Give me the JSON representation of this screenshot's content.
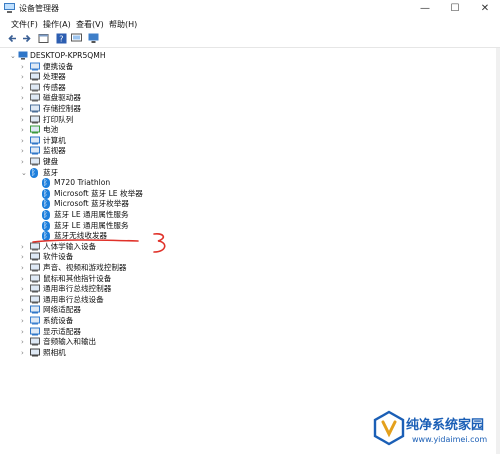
{
  "window": {
    "title": "设备管理器",
    "minimize": "—",
    "maximize": "☐",
    "close": "✕"
  },
  "menu": [
    "文件(F)",
    "操作(A)",
    "查看(V)",
    "帮助(H)"
  ],
  "tree": {
    "root": "DESKTOP-KPR5QMH",
    "categories": [
      {
        "label": "便携设备",
        "icon": "portable-device-icon",
        "expanded": false
      },
      {
        "label": "处理器",
        "icon": "processor-icon",
        "expanded": false
      },
      {
        "label": "传感器",
        "icon": "sensor-icon",
        "expanded": false
      },
      {
        "label": "磁盘驱动器",
        "icon": "disk-drive-icon",
        "expanded": false
      },
      {
        "label": "存储控制器",
        "icon": "storage-controller-icon",
        "expanded": false
      },
      {
        "label": "打印队列",
        "icon": "printer-icon",
        "expanded": false
      },
      {
        "label": "电池",
        "icon": "battery-icon",
        "expanded": false
      },
      {
        "label": "计算机",
        "icon": "computer-icon",
        "expanded": false
      },
      {
        "label": "监视器",
        "icon": "monitor-icon",
        "expanded": false
      },
      {
        "label": "键盘",
        "icon": "keyboard-icon",
        "expanded": false
      },
      {
        "label": "蓝牙",
        "icon": "bluetooth-icon",
        "expanded": true,
        "children": [
          "M720 Triathlon",
          "Microsoft 蓝牙 LE 枚举器",
          "Microsoft 蓝牙枚举器",
          "蓝牙 LE 通用属性服务",
          "蓝牙 LE 通用属性服务",
          "蓝牙无线收发器"
        ]
      },
      {
        "label": "人体学输入设备",
        "icon": "hid-icon",
        "expanded": false
      },
      {
        "label": "软件设备",
        "icon": "software-device-icon",
        "expanded": false
      },
      {
        "label": "声音、视频和游戏控制器",
        "icon": "sound-icon",
        "expanded": false
      },
      {
        "label": "鼠标和其他指针设备",
        "icon": "mouse-icon",
        "expanded": false
      },
      {
        "label": "通用串行总线控制器",
        "icon": "usb-icon",
        "expanded": false
      },
      {
        "label": "通用串行总线设备",
        "icon": "usb-device-icon",
        "expanded": false
      },
      {
        "label": "网络适配器",
        "icon": "network-adapter-icon",
        "expanded": false
      },
      {
        "label": "系统设备",
        "icon": "system-device-icon",
        "expanded": false
      },
      {
        "label": "显示适配器",
        "icon": "display-adapter-icon",
        "expanded": false
      },
      {
        "label": "音频输入和输出",
        "icon": "audio-io-icon",
        "expanded": false
      },
      {
        "label": "照相机",
        "icon": "camera-icon",
        "expanded": false
      }
    ]
  },
  "annotation": {
    "mark": "3",
    "color": "#e0322a"
  },
  "watermark": {
    "title": "纯净系统家园",
    "url": "www.yidaimei.com",
    "color": "#1b5fb6"
  },
  "gutter": [
    "ı",
    "ı",
    "ı",
    "ı",
    "ı",
    "ı"
  ]
}
